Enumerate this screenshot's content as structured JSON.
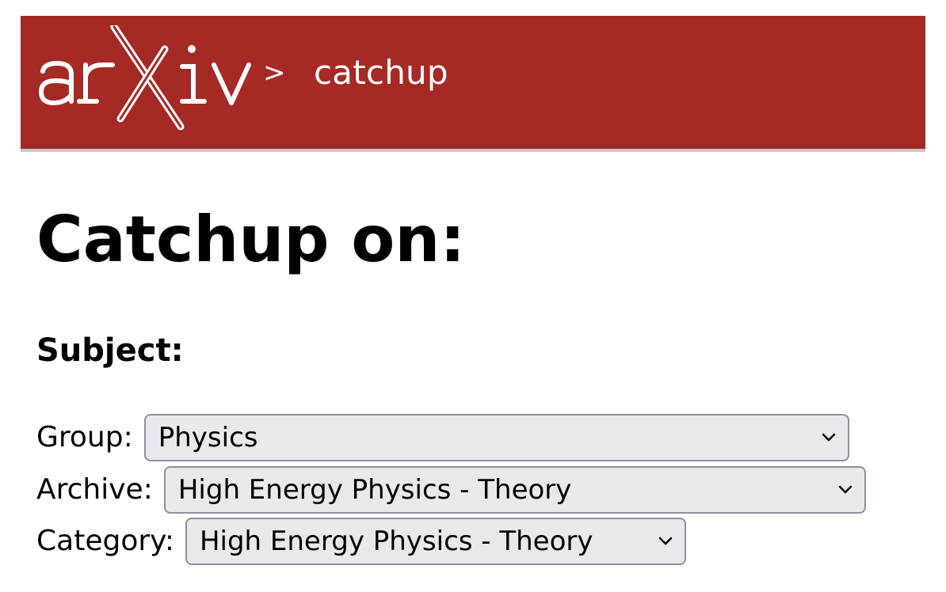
{
  "header": {
    "logo_text": "arXiv",
    "separator": ">",
    "breadcrumb": "catchup",
    "background_color": "#a52a25"
  },
  "main": {
    "title": "Catchup on:",
    "subject_heading": "Subject:",
    "fields": {
      "group": {
        "label": "Group:",
        "value": "Physics"
      },
      "archive": {
        "label": "Archive:",
        "value": "High Energy Physics - Theory"
      },
      "category": {
        "label": "Category:",
        "value": "High Energy Physics - Theory"
      }
    }
  },
  "icons": {
    "dropdown": "chevron-down-icon"
  }
}
